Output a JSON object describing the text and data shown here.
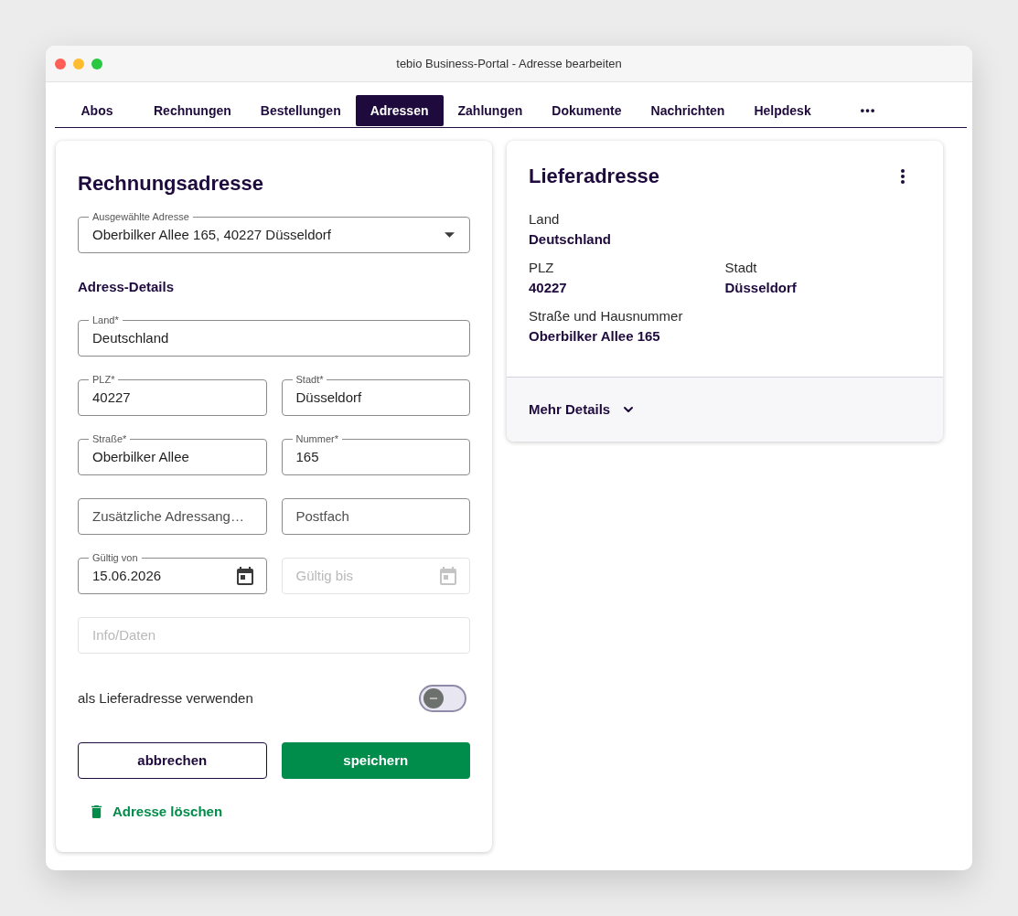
{
  "window": {
    "title": "tebio Business-Portal - Adresse bearbeiten"
  },
  "tabs": [
    {
      "label": "Abos",
      "selected": false
    },
    {
      "label": "Rechnungen",
      "selected": false
    },
    {
      "label": "Bestellungen",
      "selected": false
    },
    {
      "label": "Adressen",
      "selected": true
    },
    {
      "label": "Zahlungen",
      "selected": false
    },
    {
      "label": "Dokumente",
      "selected": false
    },
    {
      "label": "Nachrichten",
      "selected": false
    },
    {
      "label": "Helpdesk",
      "selected": false
    }
  ],
  "billing": {
    "title": "Rechnungsadresse",
    "address_select": {
      "label": "Ausgewählte Adresse",
      "value": "Oberbilker Allee 165, 40227 Düsseldorf"
    },
    "section_title": "Adress-Details",
    "field_rows": [
      [
        {
          "kind": "text",
          "label": "Land*",
          "value": "Deutschland",
          "disabled": false
        }
      ],
      [
        {
          "kind": "text",
          "label": "PLZ*",
          "value": "40227",
          "disabled": false
        },
        {
          "kind": "text",
          "label": "Stadt*",
          "value": "Düsseldorf",
          "disabled": false
        }
      ],
      [
        {
          "kind": "text",
          "label": "Straße*",
          "value": "Oberbilker Allee",
          "disabled": false
        },
        {
          "kind": "text",
          "label": "Nummer*",
          "value": "165",
          "disabled": false
        }
      ],
      [
        {
          "kind": "text",
          "placeholder": "Zusätzliche Adressang…",
          "disabled": false
        },
        {
          "kind": "text",
          "placeholder": "Postfach",
          "disabled": false
        }
      ],
      [
        {
          "kind": "date",
          "label": "Gültig von",
          "value": "15.06.2026",
          "disabled": false
        },
        {
          "kind": "date",
          "placeholder": "Gültig bis",
          "disabled": true
        }
      ],
      [
        {
          "kind": "text",
          "placeholder": "Info/Daten",
          "disabled": true
        }
      ]
    ],
    "delivery_toggle": {
      "label": "als Lieferadresse verwenden",
      "on": false
    },
    "cancel_button": "abbrechen",
    "save_button": "speichern",
    "delete_link": "Adresse löschen"
  },
  "delivery": {
    "title": "Lieferadresse",
    "detail_rows": [
      [
        {
          "label": "Land",
          "value": "Deutschland"
        }
      ],
      [
        {
          "label": "PLZ",
          "value": "40227"
        },
        {
          "label": "Stadt",
          "value": "Düsseldorf"
        }
      ],
      [
        {
          "label": "Straße und Hausnummer",
          "value": "Oberbilker Allee 165"
        }
      ]
    ],
    "more_details": {
      "label": "Mehr Details",
      "expanded": false
    }
  }
}
